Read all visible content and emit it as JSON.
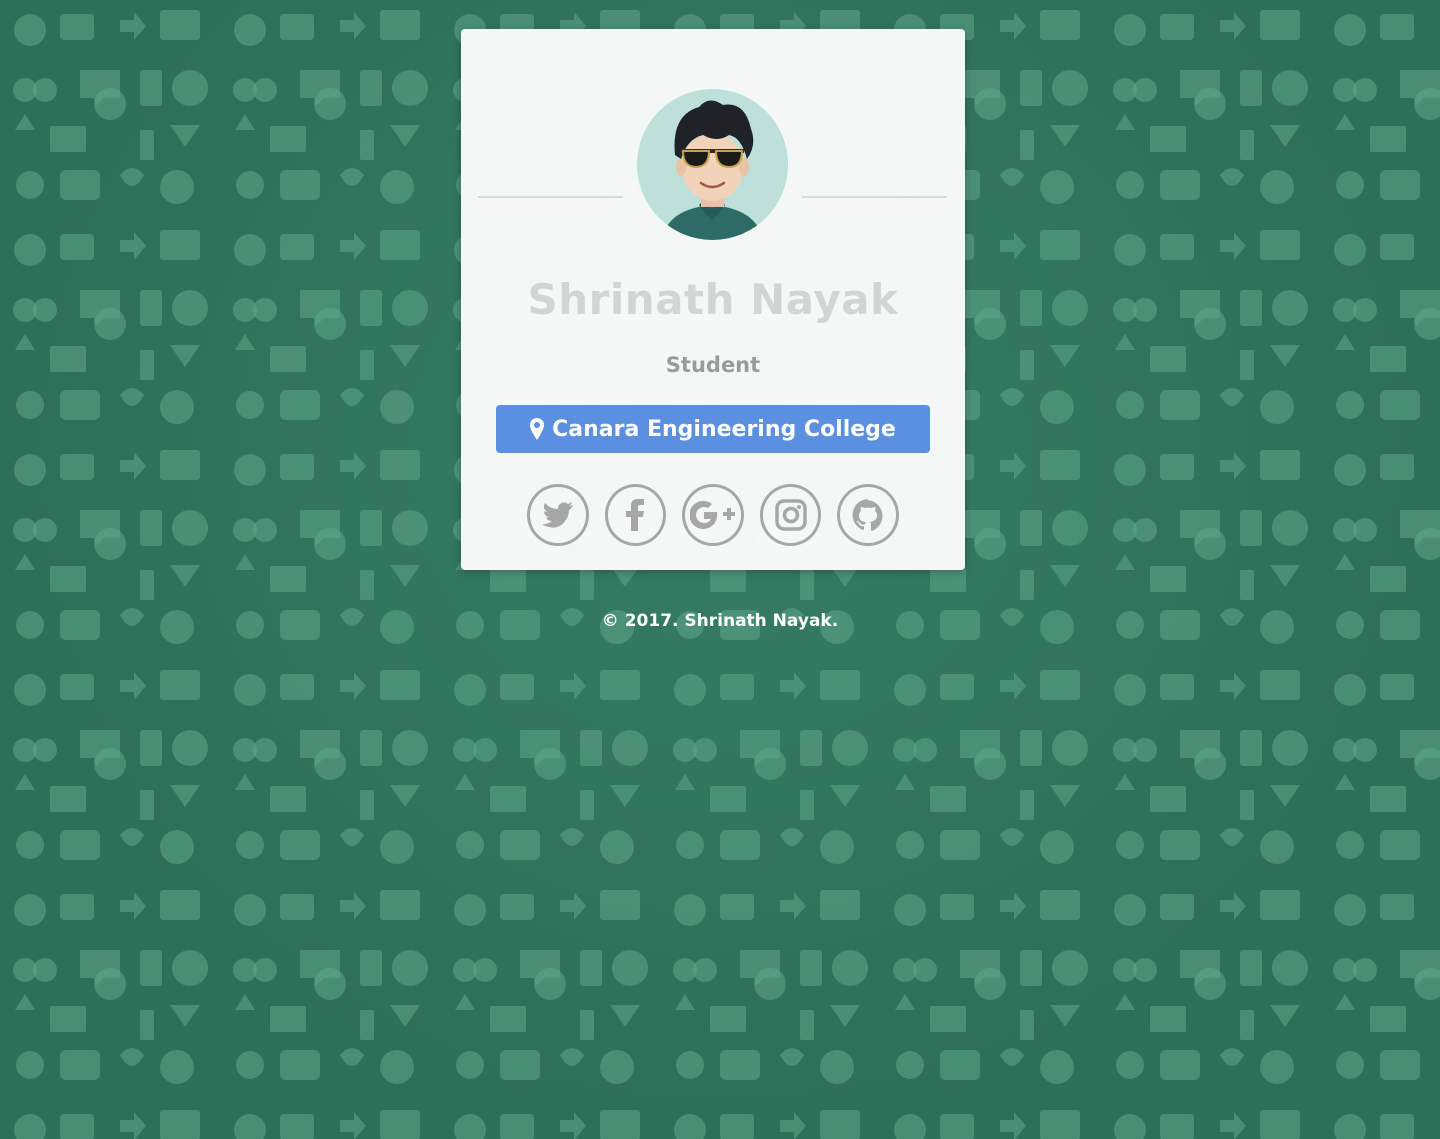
{
  "profile": {
    "name": "Shrinath Nayak",
    "role": "Student",
    "location": "Canara Engineering College"
  },
  "social_links": [
    {
      "icon": "twitter-icon"
    },
    {
      "icon": "facebook-icon"
    },
    {
      "icon": "google-plus-icon"
    },
    {
      "icon": "instagram-icon"
    },
    {
      "icon": "github-icon"
    }
  ],
  "footer": {
    "text": "© 2017. Shrinath Nayak."
  },
  "colors": {
    "background": "#2d6f59",
    "card": "#fafcfc",
    "accent": "#5b8fe0",
    "name_text": "#d3d5d5",
    "role_text": "#9b9b9b",
    "icon_gray": "#a7a7a7"
  }
}
